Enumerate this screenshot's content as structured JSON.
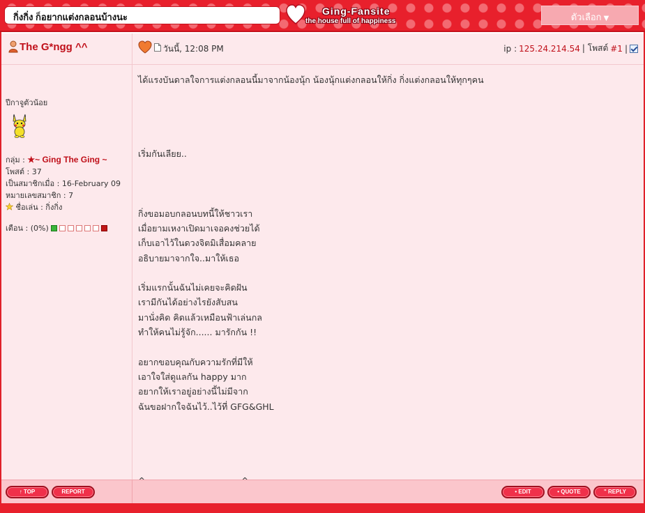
{
  "header": {
    "thread_title": "กิ่งกิ่ง ก็อยากแต่งกลอนบ้างนะ",
    "logo_name": "Ging-Fansite",
    "logo_tagline": "the house full of happiness",
    "options_label": "ตัวเลือก"
  },
  "author": {
    "name": "The G*ngg ^^",
    "title": "ปีกาจูตัวน้อย",
    "group_label": "กลุ่ม :",
    "group_name": "★~ Ging The Ging ~",
    "posts": "โพสต์ : 37",
    "joined": "เป็นสมาชิกเมื่อ : 16-February 09",
    "member_no": "หมายเลขสมาชิก : 7",
    "nickname": "ชื่อเล่น : กิ่งกิ่ง",
    "warn_label": "เตือน : (0%)"
  },
  "post": {
    "date": "วันนี้, 12:08 PM",
    "ip_label": "ip :",
    "ip": "125.24.214.54",
    "post_label": "| โพสต์",
    "post_num": "#1",
    "sep": "|",
    "lines": [
      "ได้แรงบันดาลใจการแต่งกลอนนี้มาจากน้องนุ้ก น้องนุ้กแต่งกลอนให้กิ่ง กิ่งแต่งกลอนให้ทุกๆคน",
      "",
      "",
      "",
      "",
      "เริ่มกันเลียย..",
      "",
      "",
      "",
      "กิ่งขอมอบกลอนบทนี้ให้ชาวเรา",
      "เมื่อยามเหงาเปิดมาเจอคงช่วยได้",
      "เก็บเอาไว้ในดวงจิตมิเสื่อมคลาย",
      "อธิบายมาจากใจ..มาให้เธอ",
      "",
      "เริ่มแรกนั้นฉันไม่เคยจะคิดฝัน",
      "เรามีกันได้อย่างไรยังสับสน",
      "มานั่งคิด คิดแล้วเหมือนฟ้าเล่นกล",
      "ทำให้คนไม่รู้จัก...... มารักกัน !!",
      "",
      "อยากขอบคุณกับความรักที่มีให้",
      "เอาใจใส่ดูแลกัน happy มาก",
      "อยากให้เราอยู่อย่างนี้ไม่มีจาก",
      "ฉันขอฝากใจฉันไว้..ไว้ที่ GFG&GHL",
      "",
      "",
      "",
      "",
      "^______________________^"
    ]
  },
  "buttons": {
    "top": "↑ TOP",
    "report": "REPORT",
    "edit": "• EDIT",
    "quote": "• QUOTE",
    "reply": "\" REPLY"
  },
  "colors": {
    "accent_red": "#e8202c",
    "post_bg": "#fde9ec",
    "name_red": "#c0101a"
  }
}
